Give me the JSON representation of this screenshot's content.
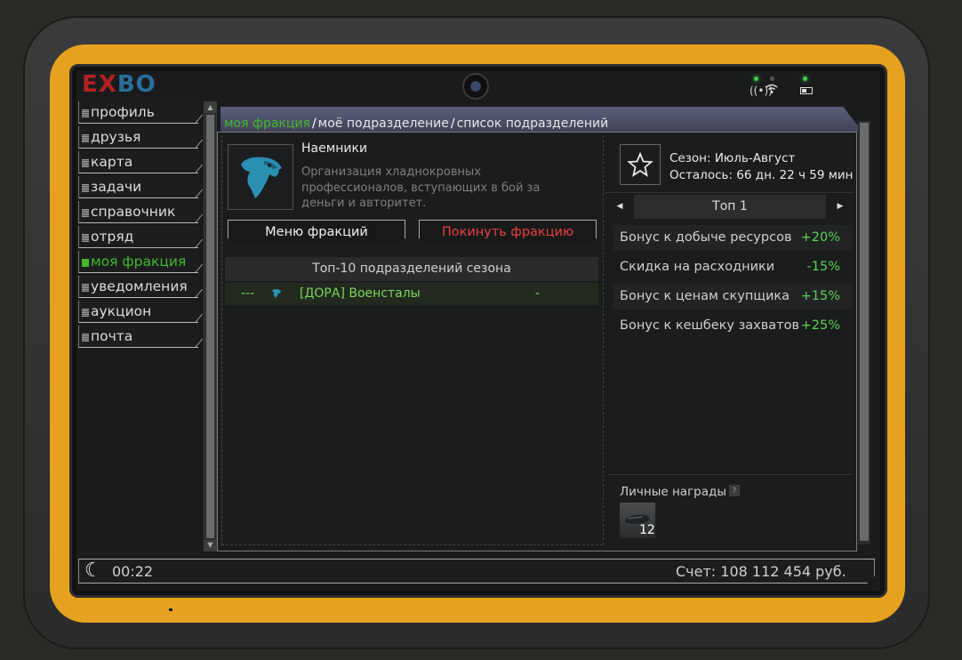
{
  "brand": {
    "logo_e": "E",
    "logo_x": "X",
    "logo_rest": "BO"
  },
  "colors": {
    "accent_green": "#41b92c",
    "danger_red": "#e84040",
    "frame_yellow": "#e6a21f",
    "value_green": "#58d155"
  },
  "sidebar": {
    "items": [
      {
        "label": "профиль"
      },
      {
        "label": "друзья"
      },
      {
        "label": "карта"
      },
      {
        "label": "задачи"
      },
      {
        "label": "справочник"
      },
      {
        "label": "отряд"
      },
      {
        "label": "моя фракция",
        "active": true
      },
      {
        "label": "уведомления"
      },
      {
        "label": "аукцион"
      },
      {
        "label": "почта"
      }
    ]
  },
  "breadcrumb": {
    "items": [
      "моя фракция",
      "моё подразделение",
      "список подразделений"
    ],
    "separator": "/"
  },
  "faction": {
    "name": "Наемники",
    "description": "Организация хладнокровных профессионалов, вступающих в бой за деньги и авторитет.",
    "emblem_icon": "eagle-head-icon"
  },
  "buttons": {
    "menu": "Меню фракций",
    "leave": "Покинуть фракцию"
  },
  "top_list": {
    "header": "Топ-10 подразделений сезона",
    "rows": [
      {
        "rank": "---",
        "name": "[ДОРА] Военсталы",
        "points": "-"
      }
    ]
  },
  "season": {
    "title": "Сезон: Июль-Август",
    "remaining": "Осталось: 66 дн. 22 ч 59 мин",
    "tier": "Топ 1",
    "bonuses": [
      {
        "label": "Бонус к добыче ресурсов",
        "value": "+20%"
      },
      {
        "label": "Скидка на расходники",
        "value": "-15%"
      },
      {
        "label": "Бонус к ценам скупщика",
        "value": "+15%"
      },
      {
        "label": "Бонус к кешбеку захватов",
        "value": "+25%"
      }
    ],
    "rewards_label": "Личные награды",
    "help": "?",
    "reward_count": "12"
  },
  "status": {
    "time": "00:22",
    "balance": "Счет: 108 112 454 руб."
  }
}
